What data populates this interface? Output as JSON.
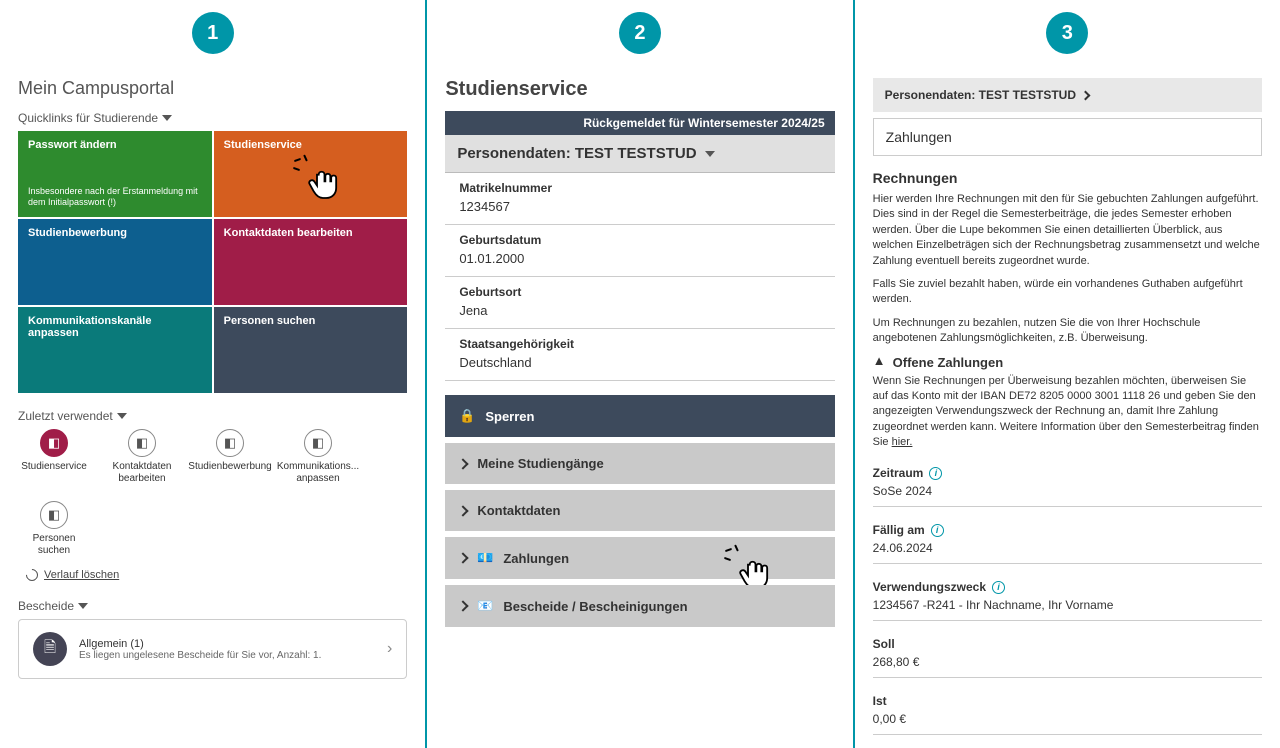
{
  "steps": {
    "one": "1",
    "two": "2",
    "three": "3"
  },
  "panel1": {
    "title": "Mein Campusportal",
    "quicklinks_label": "Quicklinks für Studierende",
    "tiles": {
      "password": {
        "title": "Passwort ändern",
        "sub": "Insbesondere nach der Erstanmeldung mit dem Initialpasswort (!)"
      },
      "studyservice": {
        "title": "Studienservice"
      },
      "application": {
        "title": "Studienbewerbung"
      },
      "contact": {
        "title": "Kontaktdaten bearbeiten"
      },
      "channels": {
        "title": "Kommunikationskanäle anpassen"
      },
      "search": {
        "title": "Personen suchen"
      }
    },
    "recent_label": "Zuletzt verwendet",
    "recent": [
      {
        "label": "Studienservice"
      },
      {
        "label": "Kontaktdaten bearbeiten"
      },
      {
        "label": "Studienbewerbung"
      },
      {
        "label": "Kommunikations... anpassen"
      },
      {
        "label": "Personen suchen"
      }
    ],
    "clear_history": "Verlauf löschen",
    "bescheide_label": "Bescheide",
    "notice": {
      "title": "Allgemein (1)",
      "sub": "Es liegen ungelesene Bescheide für Sie vor, Anzahl: 1."
    }
  },
  "panel2": {
    "title": "Studienservice",
    "status": "Rückgemeldet für Wintersemester 2024/25",
    "person_header": "Personendaten: TEST TESTSTUD",
    "fields": {
      "matrikel_label": "Matrikelnummer",
      "matrikel_value": "1234567",
      "birthdate_label": "Geburtsdatum",
      "birthdate_value": "01.01.2000",
      "birthplace_label": "Geburtsort",
      "birthplace_value": "Jena",
      "nationality_label": "Staatsangehörigkeit",
      "nationality_value": "Deutschland"
    },
    "accordion": {
      "sperren": "Sperren",
      "studiengaenge": "Meine Studiengänge",
      "kontakt": "Kontaktdaten",
      "zahlungen": "Zahlungen",
      "bescheide": "Bescheide / Bescheinigungen"
    }
  },
  "panel3": {
    "breadcrumb": "Personendaten: TEST TESTSTUD",
    "payments_title": "Zahlungen",
    "rechnungen_title": "Rechnungen",
    "rechnungen_text1": "Hier werden Ihre Rechnungen mit den für Sie gebuchten Zahlungen aufgeführt. Dies sind in der Regel die Semesterbeiträge, die jedes Semester erhoben werden. Über die Lupe bekommen Sie einen detaillierten Überblick, aus welchen Einzelbeträgen sich der Rechnungsbetrag zusammensetzt und welche Zahlung eventuell bereits zugeordnet wurde.",
    "rechnungen_text2": "Falls Sie zuviel bezahlt haben, würde ein vorhandenes Guthaben aufgeführt werden.",
    "rechnungen_text3": "Um Rechnungen zu bezahlen, nutzen Sie die von Ihrer Hochschule angebotenen Zahlungsmöglichkeiten, z.B. Überweisung.",
    "open_payments": "Offene Zahlungen",
    "open_text1": "Wenn Sie Rechnungen per Überweisung bezahlen möchten, überweisen Sie auf das Konto mit der IBAN DE72 8205 0000 3001 1118 26 und geben Sie den angezeigten Verwendungszweck der Rechnung an, damit Ihre Zahlung zugeordnet werden kann. Weitere Information über den Semesterbeitrag finden Sie ",
    "hier": "hier.",
    "details": {
      "zeitraum_label": "Zeitraum",
      "zeitraum_value": "SoSe 2024",
      "faellig_label": "Fällig am",
      "faellig_value": "24.06.2024",
      "zweck_label": "Verwendungszweck",
      "zweck_value": "1234567 -R241 - Ihr Nachname, Ihr Vorname",
      "soll_label": "Soll",
      "soll_value": "268,80 €",
      "ist_label": "Ist",
      "ist_value": "0,00 €"
    }
  }
}
